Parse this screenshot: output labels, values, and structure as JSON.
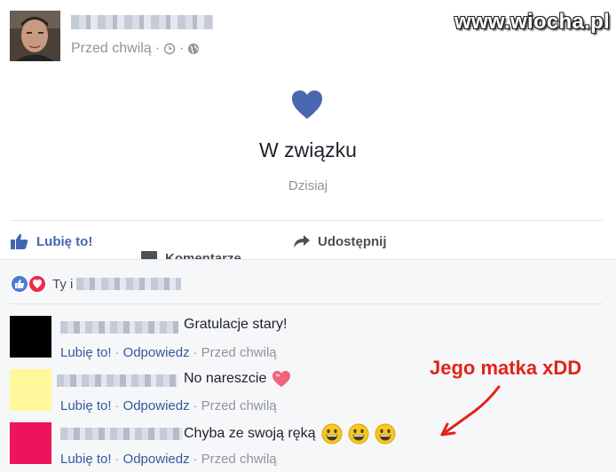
{
  "post": {
    "timestamp": "Przed chwilą",
    "meta_separator": "·"
  },
  "watermark": "www.wiocha.pl",
  "life_event": {
    "title": "W związku",
    "date": "Dzisiaj"
  },
  "actions": {
    "like": "Lubię to!",
    "comment": "Komentarze",
    "share": "Udostępnij"
  },
  "reactions": {
    "text": "Ty i"
  },
  "comments": [
    {
      "text": "Gratulacje stary!",
      "avatar_color": "#000000",
      "like": "Lubię to!",
      "reply": "Odpowiedz",
      "time": "Przed chwilą",
      "sep": "·"
    },
    {
      "text": "No nareszcie",
      "avatar_color": "#fff79a",
      "like": "Lubię to!",
      "reply": "Odpowiedz",
      "time": "Przed chwilą",
      "sep": "·"
    },
    {
      "text": "Chyba ze swoją ręką",
      "avatar_color": "#ec145a",
      "like": "Lubię to!",
      "reply": "Odpowiedz",
      "time": "Przed chwilą",
      "sep": "·"
    }
  ],
  "annotation": "Jego matka xDD",
  "colors": {
    "link": "#365899",
    "like_blue": "#4267b2",
    "heart": "#4a67b0",
    "annotation_red": "#e3231a"
  },
  "icons": [
    "clock-icon",
    "globe-icon",
    "heart-icon",
    "thumb-up-icon",
    "comment-icon",
    "share-icon",
    "love-reaction-icon",
    "like-reaction-icon",
    "smiley-icon"
  ]
}
